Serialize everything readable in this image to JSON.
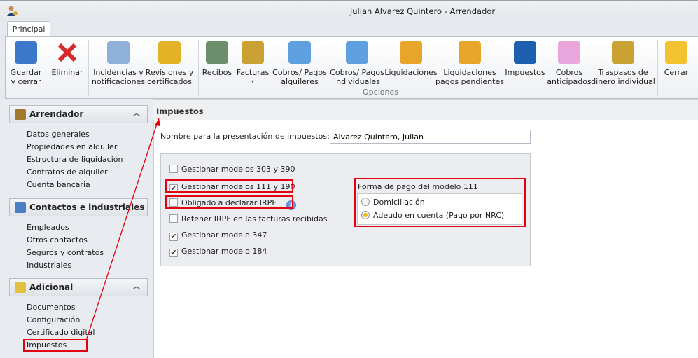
{
  "window": {
    "title": "Julian Alvarez Quintero - Arrendador",
    "app_icon": "user-icon"
  },
  "tabs": [
    {
      "label": "Principal",
      "active": true
    }
  ],
  "ribbon": {
    "group_label": "Opciones",
    "buttons": [
      {
        "l1": "Guardar",
        "l2": "y cerrar",
        "icon": "floppy-disk-icon"
      },
      {
        "l1": "Eliminar",
        "l2": "",
        "icon": "delete-x-icon"
      },
      {
        "l1": "Incidencias y",
        "l2": "notificaciones",
        "icon": "clipboard-check-icon"
      },
      {
        "l1": "Revisiones y",
        "l2": "certificados",
        "icon": "bell-document-icon"
      },
      {
        "l1": "Recibos",
        "l2": "",
        "icon": "receipt-icon"
      },
      {
        "l1": "Facturas",
        "l2": "▾",
        "icon": "invoice-coins-icon"
      },
      {
        "l1": "Cobros/ Pagos",
        "l2": "alquileres",
        "icon": "calculator-icon"
      },
      {
        "l1": "Cobros/ Pagos",
        "l2": "individuales",
        "icon": "calculator-person-icon"
      },
      {
        "l1": "Liquidaciones",
        "l2": "",
        "icon": "certificate-icon"
      },
      {
        "l1": "Liquidaciones",
        "l2": "pagos pendientes",
        "icon": "certificate-pending-icon"
      },
      {
        "l1": "Impuestos",
        "l2": "",
        "icon": "tax-agency-icon"
      },
      {
        "l1": "Cobros",
        "l2": "anticipados",
        "icon": "piggy-bank-icon"
      },
      {
        "l1": "Traspasos de",
        "l2": "dinero individual",
        "icon": "money-transfer-icon"
      },
      {
        "l1": "Cerrar",
        "l2": "",
        "icon": "folder-close-icon"
      }
    ]
  },
  "sidebar": {
    "panels": [
      {
        "title": "Arrendador",
        "icon": "door-icon",
        "items": [
          "Datos generales",
          "Propiedades en alquiler",
          "Estructura de liquidación",
          "Contratos de alquiler",
          "Cuenta bancaria"
        ]
      },
      {
        "title": "Contactos e industriales",
        "icon": "people-icon",
        "items": [
          "Empleados",
          "Otros contactos",
          "Seguros y contratos",
          "Industriales"
        ]
      },
      {
        "title": "Adicional",
        "icon": "cylinder-icon",
        "items": [
          "Documentos",
          "Configuración",
          "Certificado digital",
          "Impuestos"
        ]
      }
    ],
    "selected": "Impuestos"
  },
  "content": {
    "header": "Impuestos",
    "name_label": "Nombre para la presentación de impuestos:",
    "name_value": "Alvarez Quintero, Julian",
    "checkboxes": [
      {
        "label": "Gestionar modelos 303 y 390",
        "checked": false
      },
      {
        "label": "Gestionar modelos 111 y 190",
        "checked": true
      },
      {
        "label": "Obligado a declarar IRPF",
        "checked": false
      },
      {
        "label": "Retener IRPF en las facturas recibidas",
        "checked": false
      },
      {
        "label": "Gestionar modelo 347",
        "checked": true
      },
      {
        "label": "Gestionar modelo 184",
        "checked": true
      }
    ],
    "payment": {
      "title": "Forma de pago del modelo 111",
      "options": [
        {
          "label": "Domiciliación",
          "selected": false
        },
        {
          "label": "Adeudo en cuenta (Pago por NRC)",
          "selected": true
        }
      ]
    }
  },
  "colors": {
    "highlight": "#e4000f"
  }
}
